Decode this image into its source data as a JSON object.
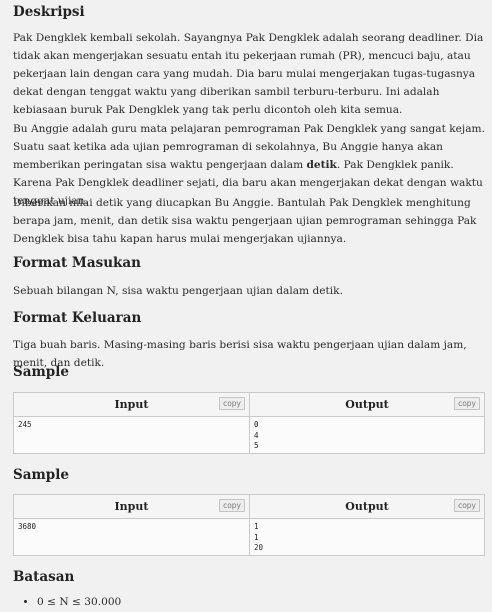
{
  "sections": {
    "deskripsi": "Deskripsi",
    "format_masukan": "Format Masukan",
    "format_keluaran": "Format Keluaran",
    "sample1": "Sample",
    "sample2": "Sample",
    "batasan": "Batasan"
  },
  "description": {
    "p1": "Pak Dengklek kembali sekolah. Sayangnya Pak Dengklek adalah seorang deadliner. Dia tidak akan mengerjakan sesuatu entah itu pekerjaan rumah (PR), mencuci baju, atau pekerjaan lain dengan cara yang mudah. Dia baru mulai mengerjakan tugas-tugasnya dekat dengan tenggat waktu yang diberikan sambil terburu-terburu. Ini adalah kebiasaan buruk Pak Dengklek yang tak perlu dicontoh oleh kita semua.",
    "p2_before": "Bu Anggie adalah guru mata pelajaran pemrograman Pak Dengklek yang sangat kejam. Suatu saat ketika ada ujian pemrograman di sekolahnya, Bu Anggie hanya akan memberikan peringatan sisa waktu pengerjaan dalam ",
    "p2_bold": "detik",
    "p2_after": ". Pak Dengklek panik. Karena Pak Dengklek deadliner sejati, dia baru akan mengerjakan dekat dengan waktu tenggat ujian.",
    "p3": "Diberikan nilai detik yang diucapkan Bu Anggie. Bantulah Pak Dengklek menghitung berapa jam, menit, dan detik sisa waktu pengerjaan ujian pemrograman sehingga Pak Dengklek bisa tahu kapan harus mulai mengerjakan ujiannya."
  },
  "format_masukan_text": "Sebuah bilangan N, sisa waktu pengerjaan ujian dalam detik.",
  "format_keluaran_text": "Tiga buah baris. Masing-masing baris berisi sisa waktu pengerjaan ujian dalam jam, menit, dan detik.",
  "samples": [
    {
      "input_label": "Input",
      "output_label": "Output",
      "copy_label": "copy",
      "input": "245",
      "output": "0\n4\n5"
    },
    {
      "input_label": "Input",
      "output_label": "Output",
      "copy_label": "copy",
      "input": "3680",
      "output": "1\n1\n20"
    }
  ],
  "constraints": [
    "0 ≤ N ≤ 30.000"
  ]
}
